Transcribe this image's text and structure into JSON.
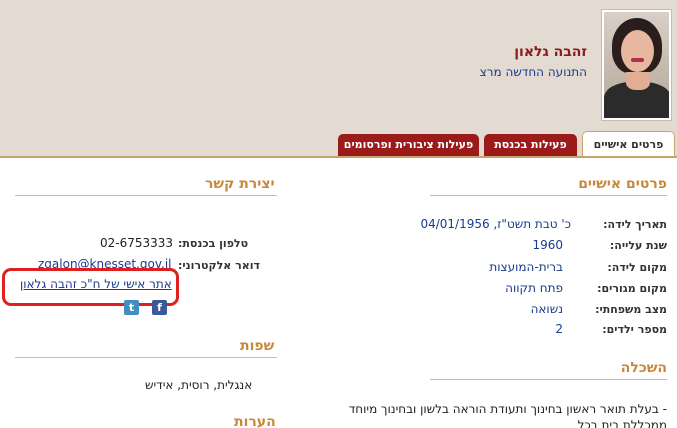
{
  "profile": {
    "name": "זהבה גלאון",
    "party": "התנועה החדשה מרצ"
  },
  "tabs": [
    {
      "label": "פרטים אישיים",
      "active": true
    },
    {
      "label": "פעילות בכנסת",
      "active": false
    },
    {
      "label": "פעילות ציבורית ופרסומים",
      "active": false
    }
  ],
  "personal": {
    "title": "פרטים אישיים",
    "fields": [
      {
        "label": "תאריך לידה:",
        "value": "כ' טבת תשט\"ז, 04/01/1956"
      },
      {
        "label": "שנת עלייה:",
        "value": "1960"
      },
      {
        "label": "מקום לידה:",
        "value": "ברית-המועצות"
      },
      {
        "label": "מקום מגורים:",
        "value": "פתח תקווה"
      },
      {
        "label": "מצב משפחתי:",
        "value": "נשואה"
      },
      {
        "label": "מספר ילדים:",
        "value": "2"
      }
    ]
  },
  "contact": {
    "title": "יצירת קשר",
    "phone_label": "טלפון בכנסת:",
    "phone_value": "02-6753333",
    "email_label": "דואר אלקטרוני:",
    "email_value": "zgalon@knesset.gov.il",
    "website_link": "אתר אישי של ח\"כ זהבה גלאון",
    "twitter_icon": "twitter-icon",
    "facebook_icon": "facebook-icon"
  },
  "languages": {
    "title": "שפות",
    "value": "אנגלית, רוסית, אידיש"
  },
  "education": {
    "title": "השכלה",
    "line1": "- בעלת תואר ראשון בחינוך ותעודת הוראה בלשון ובחינוך מיוחד",
    "line2": "ממכללת בית בכל"
  },
  "notes": {
    "title": "הערות"
  },
  "colors": {
    "header_bg": "#e3dbd1",
    "tab_red": "#9b1b1b",
    "section_title": "#c8883a",
    "link_blue": "#1a3a8c",
    "highlight_red": "#e02020"
  }
}
